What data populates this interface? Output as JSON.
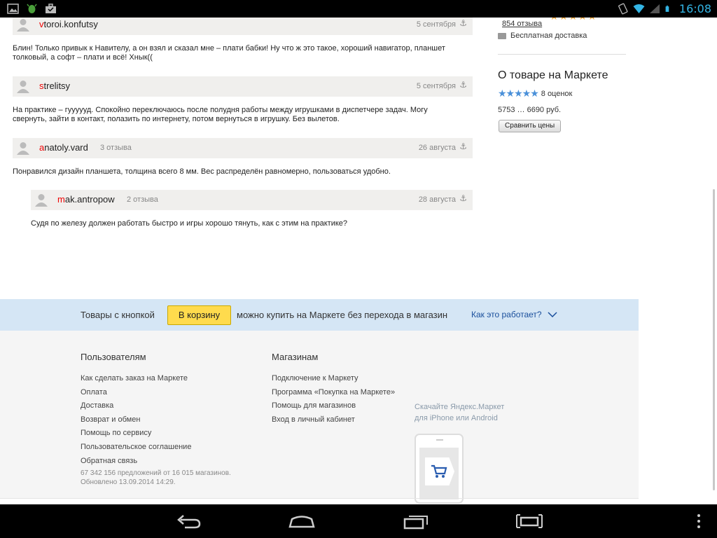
{
  "statusbar": {
    "time": "16:08",
    "left_icons": [
      "image-icon",
      "android-bug-icon",
      "briefcase-icon"
    ],
    "right_icons": [
      "vibrate-icon",
      "wifi-icon",
      "signal-icon",
      "battery-icon"
    ]
  },
  "reviews": [
    {
      "user_first": "v",
      "user_rest": "toroi.konfutsy",
      "count": "",
      "date": "5 сентября",
      "text": "Блин! Только привык к Навителу, а он взял и сказал мне – плати бабки! Ну что ж это такое, хороший навигатор, планшет толковый, а софт – плати и всё! Хнык(("
    },
    {
      "user_first": "s",
      "user_rest": "trelitsy",
      "count": "",
      "date": "5 сентября",
      "text": "На практике – гуууууд. Спокойно переключаюсь после полудня работы между игрушками в диспетчере задач. Могу свернуть, зайти в контакт, полазить по интернету, потом вернуться в игрушку. Без вылетов."
    },
    {
      "user_first": "a",
      "user_rest": "natoly.vard",
      "count": "3 отзыва",
      "date": "26 августа",
      "text": "Понравился дизайн планшета, толщина всего 8 мм. Вес распределён равномерно, пользоваться удобно."
    },
    {
      "user_first": "m",
      "user_rest": "ak.antropow",
      "count": "2 отзыва",
      "date": "28 августа",
      "text": "Судя по железу должен работать быстро и игры хорошо тянуть, как с этим на практике?"
    }
  ],
  "sidebar": {
    "reviews_link": "854 отзыва",
    "delivery": "Бесплатная доставка",
    "market_title": "О товаре на Маркете",
    "rating_text": "8 оценок",
    "price": "5753 … 6690 руб.",
    "compare_button": "Сравнить цены"
  },
  "promo": {
    "text_before": "Товары с кнопкой",
    "cart_button": "В корзину",
    "text_after": "можно купить на Маркете без перехода в магазин",
    "how_link": "Как это работает?"
  },
  "footer": {
    "users_heading": "Пользователям",
    "users_links": [
      "Как сделать заказ на Маркете",
      "Оплата",
      "Доставка",
      "Возврат и обмен",
      "Помощь по сервису",
      "Пользовательское соглашение",
      "Обратная связь"
    ],
    "shops_heading": "Магазинам",
    "shops_links": [
      "Подключение к Маркету",
      "Программа «Покупка на Маркете»",
      "Помощь для магазинов",
      "Вход в личный кабинет"
    ],
    "meta_line1": "67 342 156 предложений от 16 015 магазинов.",
    "meta_line2": "Обновлено 13.09.2014 14:29.",
    "app_line1": "Скачайте Яндекс.Маркет",
    "app_line2": "для iPhone или Android"
  },
  "colors": {
    "status_time": "#33b5e5",
    "promo_bg": "#d5e6f5",
    "cart_button": "#ffdb4d",
    "username_first_letter": "#e00000",
    "link_blue": "#1a4f9c"
  }
}
